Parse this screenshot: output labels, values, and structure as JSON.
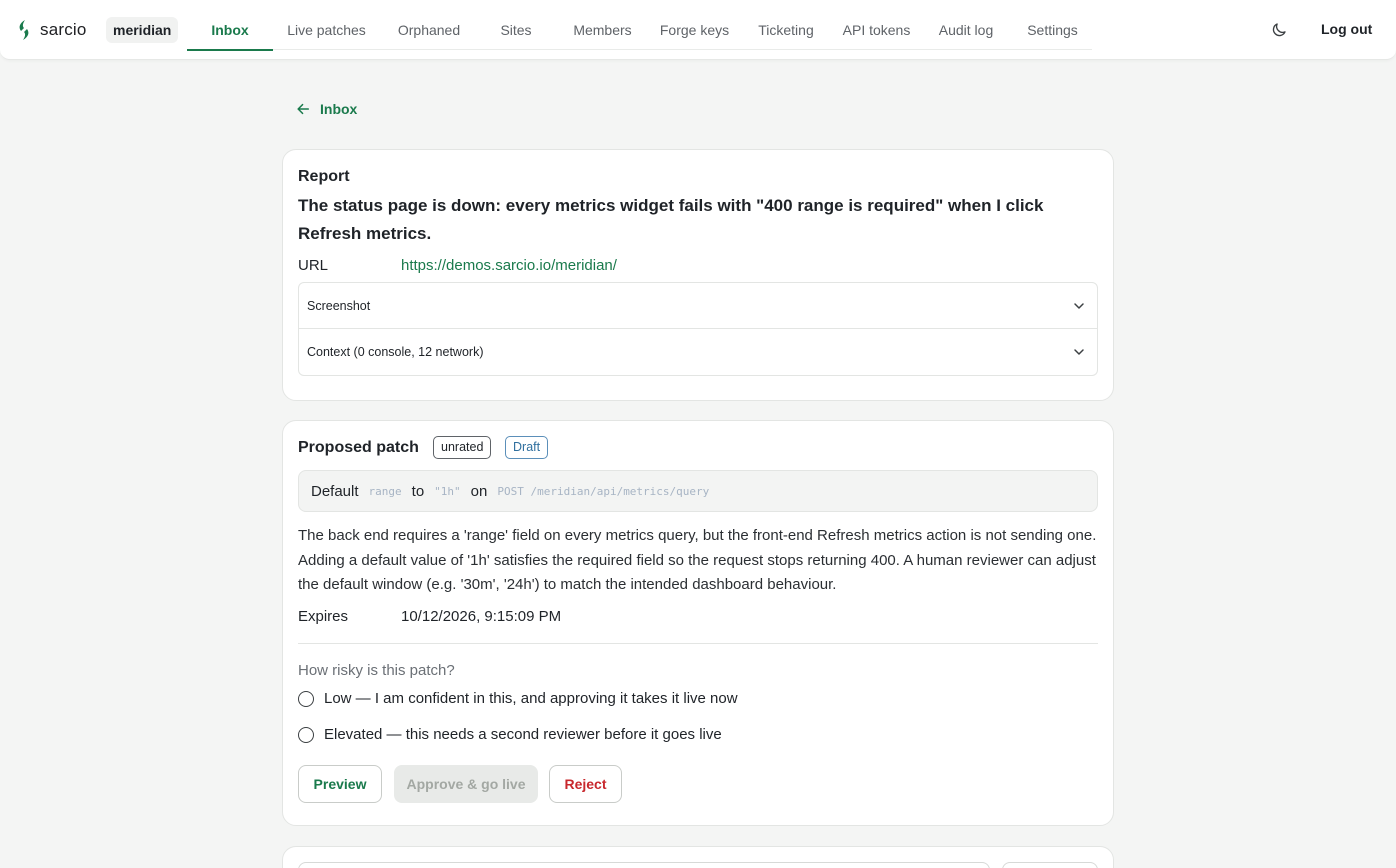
{
  "brand": {
    "name": "sarcio",
    "accent": "#1a7a4c"
  },
  "org": {
    "name": "meridian"
  },
  "nav": {
    "tabs": [
      {
        "label": "Inbox",
        "active": true
      },
      {
        "label": "Live patches"
      },
      {
        "label": "Orphaned"
      },
      {
        "label": "Sites"
      },
      {
        "label": "Members"
      },
      {
        "label": "Forge keys"
      },
      {
        "label": "Ticketing"
      },
      {
        "label": "API tokens"
      },
      {
        "label": "Audit log"
      },
      {
        "label": "Settings"
      }
    ],
    "theme_icon": "moon-icon",
    "logout_label": "Log out"
  },
  "back": {
    "label": "Inbox",
    "icon": "arrow-left-icon"
  },
  "report": {
    "heading": "Report",
    "title": "The status page is down: every metrics widget fails with \"400 range is required\" when I click Refresh metrics.",
    "url_label": "URL",
    "url": "https://demos.sarcio.io/meridian/",
    "sections": [
      {
        "label": "Screenshot",
        "icon": "chevron-down-icon"
      },
      {
        "label": "Context (0 console, 12 network)",
        "icon": "chevron-down-icon"
      }
    ]
  },
  "patch": {
    "heading": "Proposed patch",
    "badges": {
      "rating": "unrated",
      "status": "Draft"
    },
    "summary": {
      "word1": "Default",
      "field": "range",
      "word2": "to",
      "value": "\"1h\"",
      "word3": "on",
      "endpoint": "POST /meridian/api/metrics/query"
    },
    "description": "The back end requires a 'range' field on every metrics query, but the front-end Refresh metrics action is not sending one. Adding a default value of '1h' satisfies the required field so the request stops returning 400. A human reviewer can adjust the default window (e.g. '30m', '24h') to match the intended dashboard behaviour.",
    "expires_label": "Expires",
    "expires_value": "10/12/2026, 9:15:09 PM",
    "risk_question": "How risky is this patch?",
    "risk_options": [
      {
        "label": "Low — I am confident in this, and approving it takes it live now"
      },
      {
        "label": "Elevated — this needs a second reviewer before it goes live"
      }
    ],
    "actions": {
      "preview": "Preview",
      "approve": "Approve & go live",
      "reject": "Reject"
    }
  }
}
